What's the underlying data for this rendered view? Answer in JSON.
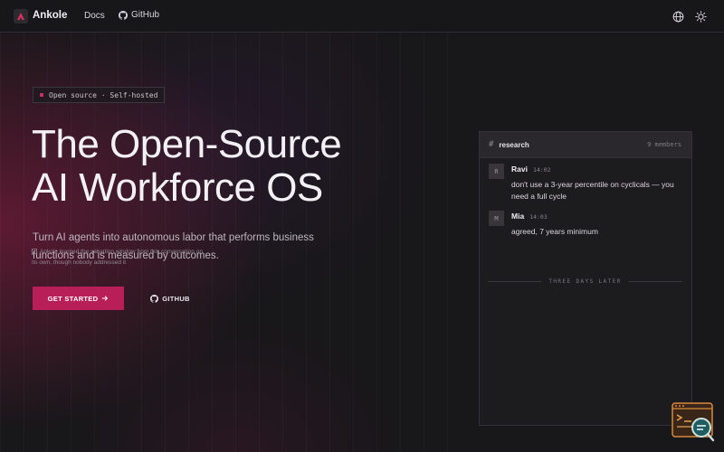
{
  "nav": {
    "brand": "Ankole",
    "links": [
      {
        "label": "Docs"
      },
      {
        "label": "GitHub"
      }
    ]
  },
  "hero": {
    "badge": "Open source · Self-hosted",
    "title_line1": "The Open-Source",
    "title_line2": "AI Workforce OS",
    "subtitle": "Turn AI agents into autonomous labor that performs business functions and is measured by outcomes.",
    "cta_primary": "GET STARTED",
    "cta_secondary": "GITHUB"
  },
  "chat": {
    "channel": "research",
    "members": "9 members",
    "messages": [
      {
        "initial": "R",
        "name": "Ravi",
        "time": "14:02",
        "text": "don't use a 3-year percentile on cyclicals — you need a full cycle"
      },
      {
        "initial": "M",
        "name": "Mia",
        "time": "14:03",
        "text": "agreed, 7 years minimum"
      }
    ],
    "note": "Ankole learned the valuation window from this conversation on its own, though nobody addressed it",
    "divider": "THREE DAYS LATER"
  },
  "colors": {
    "accent": "#b81f59",
    "background": "#18171a",
    "panel": "#1c1b1e"
  }
}
